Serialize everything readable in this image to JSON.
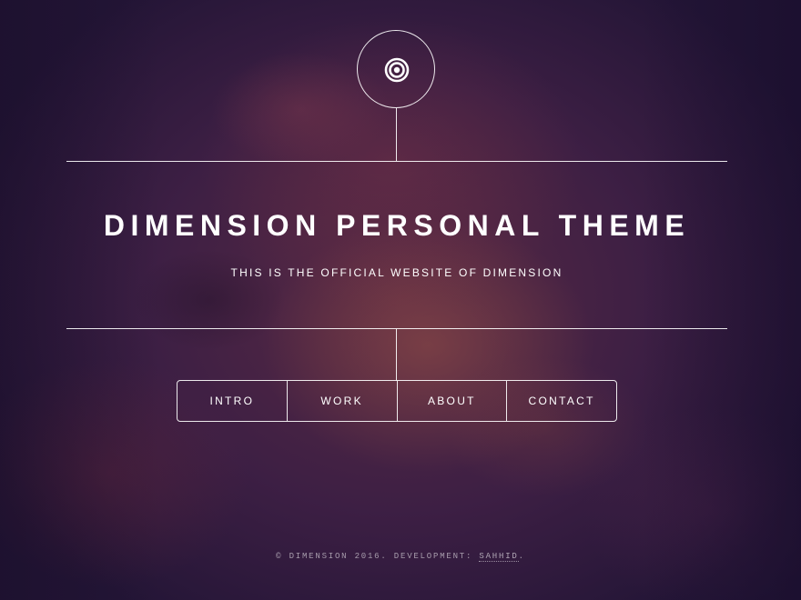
{
  "header": {
    "logo_icon": "concentric-circles-icon",
    "title": "DIMENSION PERSONAL THEME",
    "subtitle": "THIS IS THE OFFICIAL WEBSITE OF DIMENSION"
  },
  "nav": {
    "items": [
      {
        "label": "INTRO"
      },
      {
        "label": "WORK"
      },
      {
        "label": "ABOUT"
      },
      {
        "label": "CONTACT"
      }
    ]
  },
  "footer": {
    "text": "© DIMENSION 2016. DEVELOPMENT:",
    "link_label": "SAHHID",
    "suffix": "."
  },
  "colors": {
    "text": "#ffffff",
    "background_dark": "#231536",
    "background_warm": "#5a2a44"
  }
}
